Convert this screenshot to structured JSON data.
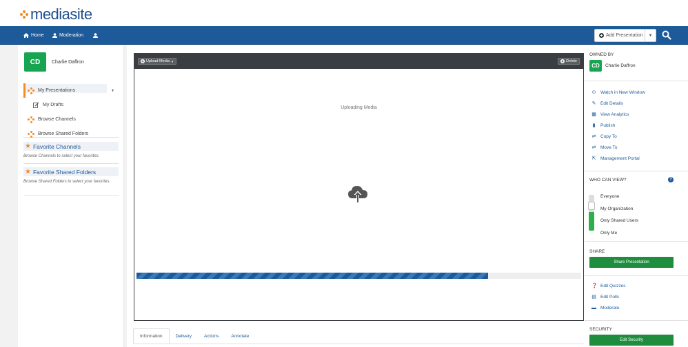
{
  "header": {
    "logo_text": "mediasite"
  },
  "nav": {
    "home": "Home",
    "moderation": "Moderation",
    "add_presentation": "Add Presentation"
  },
  "user": {
    "initials": "CD",
    "name": "Charlie Daffron"
  },
  "sidebar": {
    "items": [
      {
        "label": "My Presentations"
      },
      {
        "label": "My Drafts"
      },
      {
        "label": "Browse Channels"
      },
      {
        "label": "Browse Shared Folders"
      }
    ],
    "favorite_channels": {
      "title": "Favorite Channels",
      "note": "Browse Channels to select your favorites."
    },
    "favorite_folders": {
      "title": "Favorite Shared Folders",
      "note": "Browse Shared Folders to select your favorites."
    }
  },
  "player": {
    "upload_media": "Upload Media",
    "delete": "Delete",
    "status": "Uploading Media",
    "progress_fraction": 0.79
  },
  "tabs": [
    "Information",
    "Delivery",
    "Actions",
    "Annotate"
  ],
  "right": {
    "owned_by_title": "OWNED BY",
    "owner_initials": "CD",
    "owner_name": "Charlie Daffron",
    "actions": [
      {
        "label": "Watch in New Window",
        "icon": "play-circle-icon"
      },
      {
        "label": "Edit Details",
        "icon": "edit-icon"
      },
      {
        "label": "View Analytics",
        "icon": "chart-icon"
      },
      {
        "label": "Publish",
        "icon": "book-icon"
      },
      {
        "label": "Copy To",
        "icon": "copy-icon"
      },
      {
        "label": "Move To",
        "icon": "move-icon"
      },
      {
        "label": "Management Portal",
        "icon": "portal-icon"
      }
    ],
    "who_can_view_title": "WHO CAN VIEW?",
    "who_options": [
      "Everyone",
      "My Organization",
      "Only Shared Users",
      "Only Me"
    ],
    "share_title": "SHARE",
    "share_button": "Share Presentation",
    "tools": [
      {
        "label": "Edit Quizzes",
        "icon": "question-icon"
      },
      {
        "label": "Edit Polls",
        "icon": "poll-icon"
      },
      {
        "label": "Moderate",
        "icon": "comment-icon"
      }
    ],
    "security_title": "SECURITY",
    "security_button": "Edit Security"
  },
  "colors": {
    "navbar": "#1d5a99",
    "accent_orange": "#f28c28",
    "avatar_green": "#18a551",
    "button_green": "#1e8e3e"
  }
}
